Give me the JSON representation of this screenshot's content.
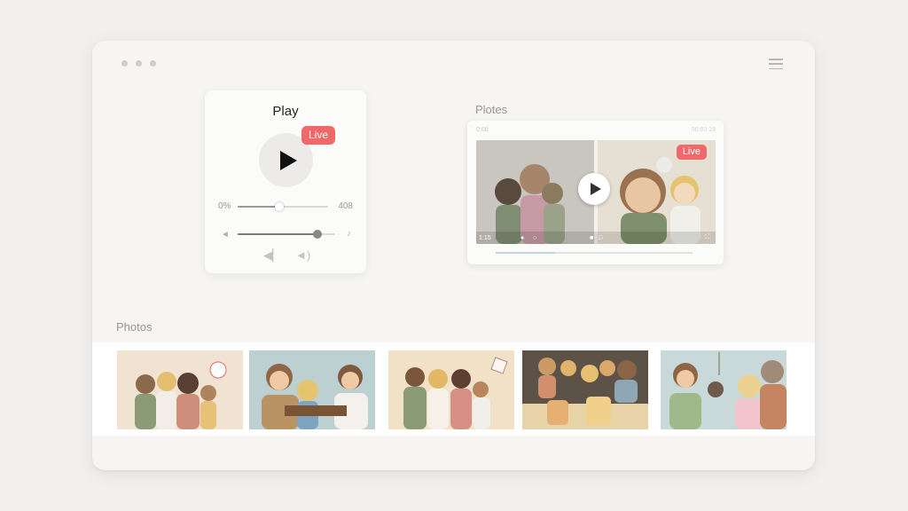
{
  "window": {
    "dots": 3
  },
  "player": {
    "title": "Play",
    "live_label": "Live",
    "progress": {
      "start_label": "0%",
      "end_label": "408",
      "fraction": 0.46
    },
    "volume": {
      "fraction": 0.82
    }
  },
  "video": {
    "section_label": "Plotes",
    "topbar_left": "0:00",
    "topbar_right": "00:00 28",
    "live_label": "Live",
    "controls_left": "1:15",
    "progress_fraction": 0.3
  },
  "photos": {
    "section_label": "Photos",
    "items": [
      {
        "name": "photo-1"
      },
      {
        "name": "photo-2"
      },
      {
        "name": "photo-3"
      },
      {
        "name": "photo-4"
      },
      {
        "name": "photo-5"
      }
    ]
  },
  "colors": {
    "accent_live": "#f0686a",
    "background": "#f1f0ef",
    "card": "#fbfbfa"
  }
}
